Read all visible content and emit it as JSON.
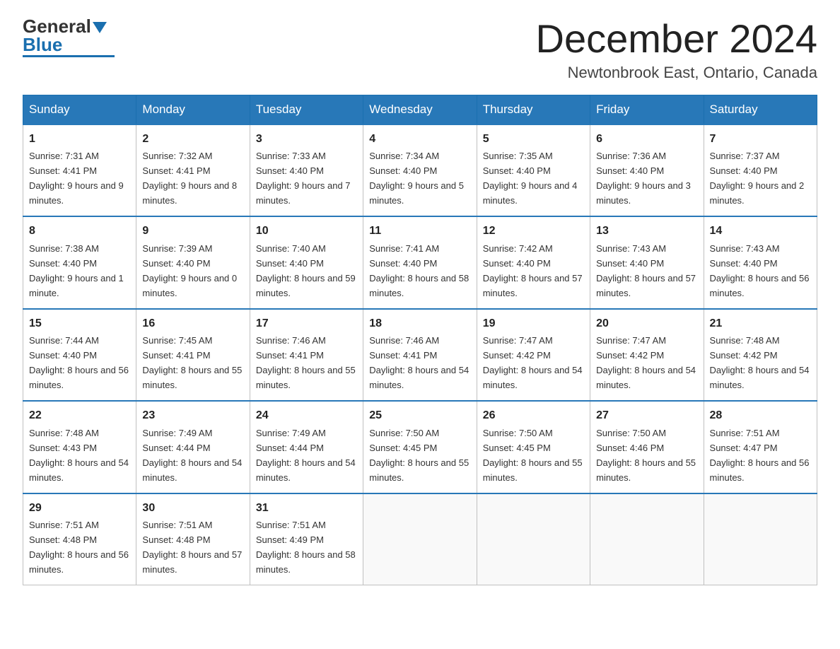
{
  "logo": {
    "general": "General",
    "blue": "Blue"
  },
  "header": {
    "month": "December 2024",
    "location": "Newtonbrook East, Ontario, Canada"
  },
  "weekdays": [
    "Sunday",
    "Monday",
    "Tuesday",
    "Wednesday",
    "Thursday",
    "Friday",
    "Saturday"
  ],
  "weeks": [
    [
      {
        "day": "1",
        "sunrise": "7:31 AM",
        "sunset": "4:41 PM",
        "daylight": "9 hours and 9 minutes."
      },
      {
        "day": "2",
        "sunrise": "7:32 AM",
        "sunset": "4:41 PM",
        "daylight": "9 hours and 8 minutes."
      },
      {
        "day": "3",
        "sunrise": "7:33 AM",
        "sunset": "4:40 PM",
        "daylight": "9 hours and 7 minutes."
      },
      {
        "day": "4",
        "sunrise": "7:34 AM",
        "sunset": "4:40 PM",
        "daylight": "9 hours and 5 minutes."
      },
      {
        "day": "5",
        "sunrise": "7:35 AM",
        "sunset": "4:40 PM",
        "daylight": "9 hours and 4 minutes."
      },
      {
        "day": "6",
        "sunrise": "7:36 AM",
        "sunset": "4:40 PM",
        "daylight": "9 hours and 3 minutes."
      },
      {
        "day": "7",
        "sunrise": "7:37 AM",
        "sunset": "4:40 PM",
        "daylight": "9 hours and 2 minutes."
      }
    ],
    [
      {
        "day": "8",
        "sunrise": "7:38 AM",
        "sunset": "4:40 PM",
        "daylight": "9 hours and 1 minute."
      },
      {
        "day": "9",
        "sunrise": "7:39 AM",
        "sunset": "4:40 PM",
        "daylight": "9 hours and 0 minutes."
      },
      {
        "day": "10",
        "sunrise": "7:40 AM",
        "sunset": "4:40 PM",
        "daylight": "8 hours and 59 minutes."
      },
      {
        "day": "11",
        "sunrise": "7:41 AM",
        "sunset": "4:40 PM",
        "daylight": "8 hours and 58 minutes."
      },
      {
        "day": "12",
        "sunrise": "7:42 AM",
        "sunset": "4:40 PM",
        "daylight": "8 hours and 57 minutes."
      },
      {
        "day": "13",
        "sunrise": "7:43 AM",
        "sunset": "4:40 PM",
        "daylight": "8 hours and 57 minutes."
      },
      {
        "day": "14",
        "sunrise": "7:43 AM",
        "sunset": "4:40 PM",
        "daylight": "8 hours and 56 minutes."
      }
    ],
    [
      {
        "day": "15",
        "sunrise": "7:44 AM",
        "sunset": "4:40 PM",
        "daylight": "8 hours and 56 minutes."
      },
      {
        "day": "16",
        "sunrise": "7:45 AM",
        "sunset": "4:41 PM",
        "daylight": "8 hours and 55 minutes."
      },
      {
        "day": "17",
        "sunrise": "7:46 AM",
        "sunset": "4:41 PM",
        "daylight": "8 hours and 55 minutes."
      },
      {
        "day": "18",
        "sunrise": "7:46 AM",
        "sunset": "4:41 PM",
        "daylight": "8 hours and 54 minutes."
      },
      {
        "day": "19",
        "sunrise": "7:47 AM",
        "sunset": "4:42 PM",
        "daylight": "8 hours and 54 minutes."
      },
      {
        "day": "20",
        "sunrise": "7:47 AM",
        "sunset": "4:42 PM",
        "daylight": "8 hours and 54 minutes."
      },
      {
        "day": "21",
        "sunrise": "7:48 AM",
        "sunset": "4:42 PM",
        "daylight": "8 hours and 54 minutes."
      }
    ],
    [
      {
        "day": "22",
        "sunrise": "7:48 AM",
        "sunset": "4:43 PM",
        "daylight": "8 hours and 54 minutes."
      },
      {
        "day": "23",
        "sunrise": "7:49 AM",
        "sunset": "4:44 PM",
        "daylight": "8 hours and 54 minutes."
      },
      {
        "day": "24",
        "sunrise": "7:49 AM",
        "sunset": "4:44 PM",
        "daylight": "8 hours and 54 minutes."
      },
      {
        "day": "25",
        "sunrise": "7:50 AM",
        "sunset": "4:45 PM",
        "daylight": "8 hours and 55 minutes."
      },
      {
        "day": "26",
        "sunrise": "7:50 AM",
        "sunset": "4:45 PM",
        "daylight": "8 hours and 55 minutes."
      },
      {
        "day": "27",
        "sunrise": "7:50 AM",
        "sunset": "4:46 PM",
        "daylight": "8 hours and 55 minutes."
      },
      {
        "day": "28",
        "sunrise": "7:51 AM",
        "sunset": "4:47 PM",
        "daylight": "8 hours and 56 minutes."
      }
    ],
    [
      {
        "day": "29",
        "sunrise": "7:51 AM",
        "sunset": "4:48 PM",
        "daylight": "8 hours and 56 minutes."
      },
      {
        "day": "30",
        "sunrise": "7:51 AM",
        "sunset": "4:48 PM",
        "daylight": "8 hours and 57 minutes."
      },
      {
        "day": "31",
        "sunrise": "7:51 AM",
        "sunset": "4:49 PM",
        "daylight": "8 hours and 58 minutes."
      },
      null,
      null,
      null,
      null
    ]
  ]
}
